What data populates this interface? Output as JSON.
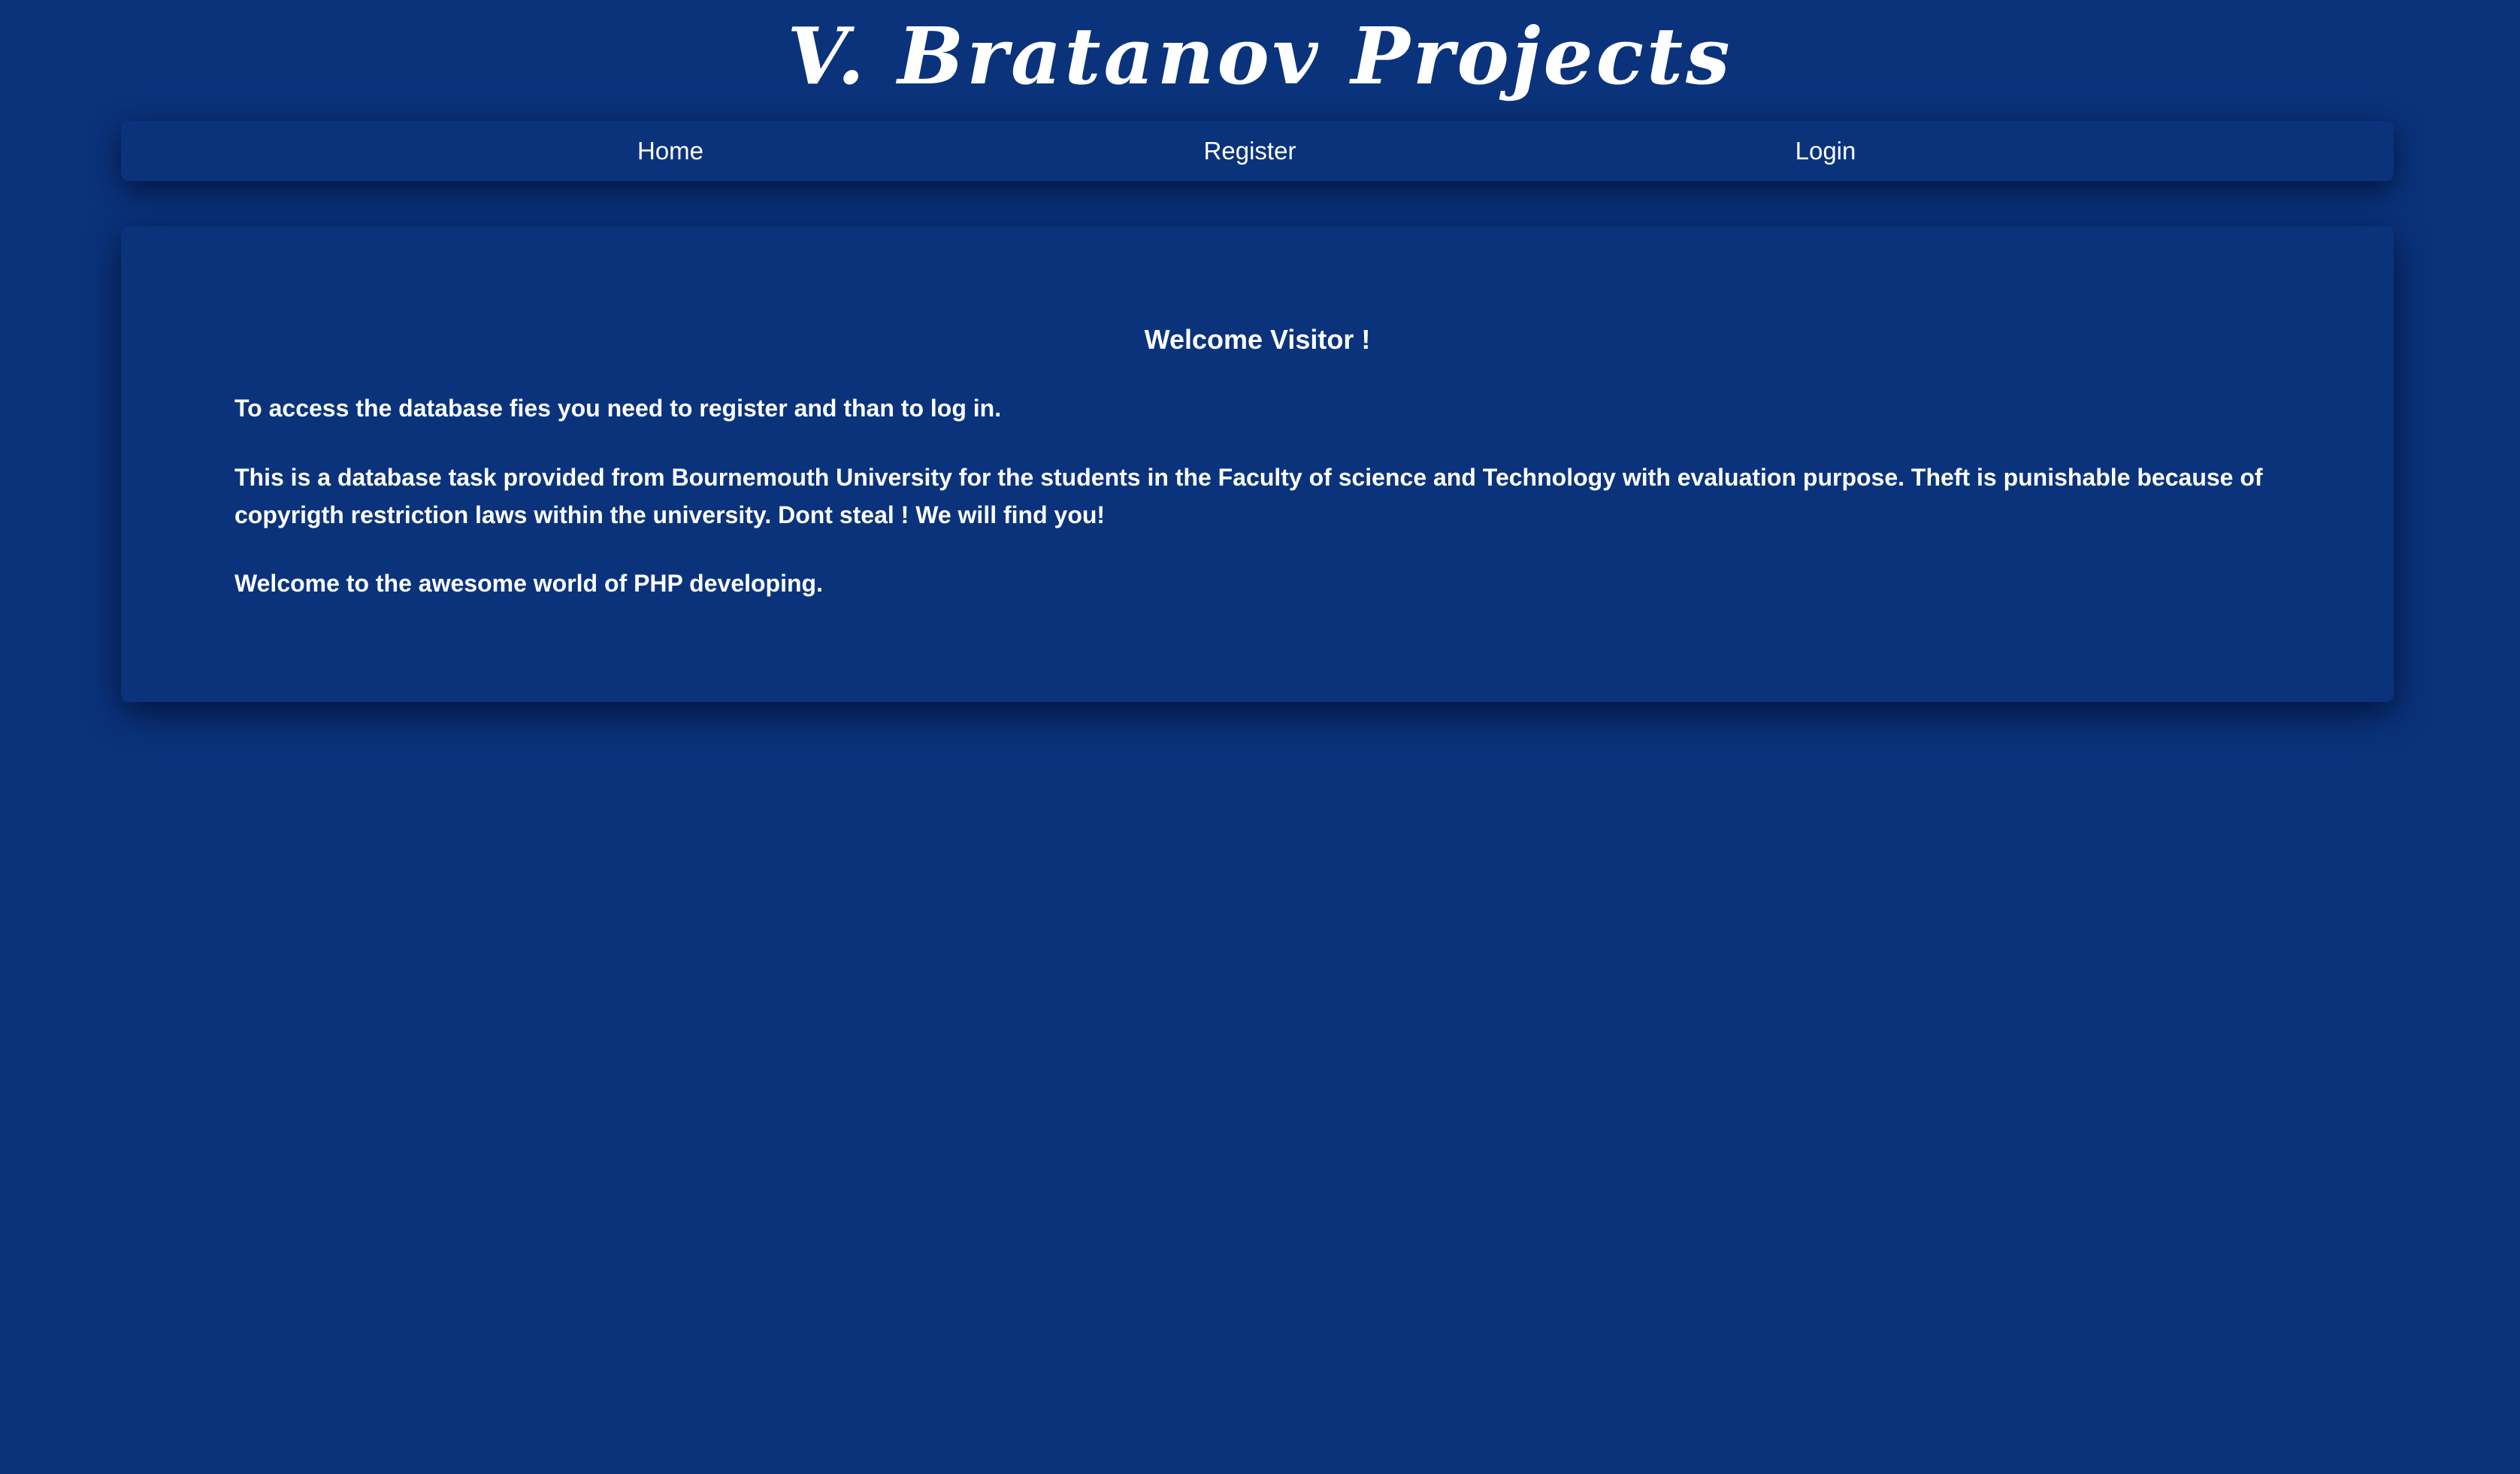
{
  "header": {
    "site_title": "V. Bratanov Projects"
  },
  "nav": {
    "items": [
      {
        "label": "Home"
      },
      {
        "label": "Register"
      },
      {
        "label": "Login"
      }
    ]
  },
  "main": {
    "heading": "Welcome Visitor !",
    "paragraphs": [
      "To access the database fies you need to register and than to log in.",
      "This is a database task provided from Bournemouth University for the students in the Faculty of science and Technology with evaluation purpose. Theft is punishable because of copyrigth restriction laws within the university. Dont steal ! We will find you!",
      "Welcome to the awesome world of PHP developing."
    ]
  },
  "colors": {
    "background": "#0a337c",
    "text": "#ffffff"
  }
}
